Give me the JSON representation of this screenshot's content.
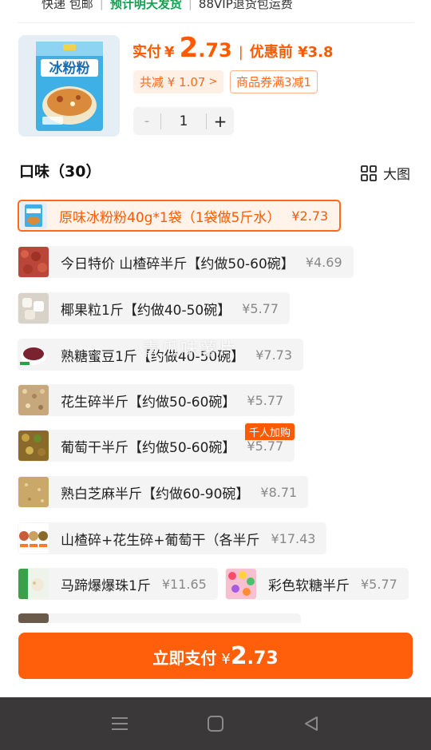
{
  "shipping": {
    "express": "快递 包邮",
    "delivery": "预计明天发货",
    "vip": "88VIP退货包运费"
  },
  "product": {
    "pay_label": "实付",
    "currency": "¥",
    "pay_int": "2",
    "pay_dec": ".73",
    "pre_price": "优惠前 ¥3.8",
    "saving": "共减 ¥ 1.07",
    "coupon": "商品券满3减1",
    "quantity": "1",
    "minus": "-",
    "plus": "+"
  },
  "options_header": {
    "title": "口味（30）",
    "big_view": "大图"
  },
  "options": [
    {
      "name": "原味冰粉粉40g*1袋（1袋做5斤水）",
      "price": "¥2.73",
      "selected": true
    },
    {
      "name": "今日特价 山楂碎半斤【约做50-60碗】",
      "price": "¥4.69"
    },
    {
      "name": "椰果粒1斤【约做40-50碗】",
      "price": "¥5.77"
    },
    {
      "name": "熟糖蜜豆1斤【约做40-50碗】",
      "price": "¥7.73"
    },
    {
      "name": "花生碎半斤【约做50-60碗】",
      "price": "¥5.77"
    },
    {
      "name": "葡萄干半斤【约做50-60碗】",
      "price": "¥5.77",
      "badge": "千人加购"
    },
    {
      "name": "熟白芝麻半斤【约做60-90碗】",
      "price": "¥8.71"
    },
    {
      "name": "山楂碎+花生碎+葡萄干（各半斤",
      "price": "¥17.43"
    },
    {
      "name": "马蹄爆爆珠1斤",
      "price": "¥11.65"
    },
    {
      "name": "彩色软糖半斤",
      "price": "¥5.77"
    }
  ],
  "watermark": "青瓜味薯片",
  "pay_button": {
    "label": "立即支付",
    "currency": "¥",
    "int": "2",
    "dec": ".73"
  },
  "colors": {
    "accent": "#ff5a00",
    "green": "#12a150"
  }
}
